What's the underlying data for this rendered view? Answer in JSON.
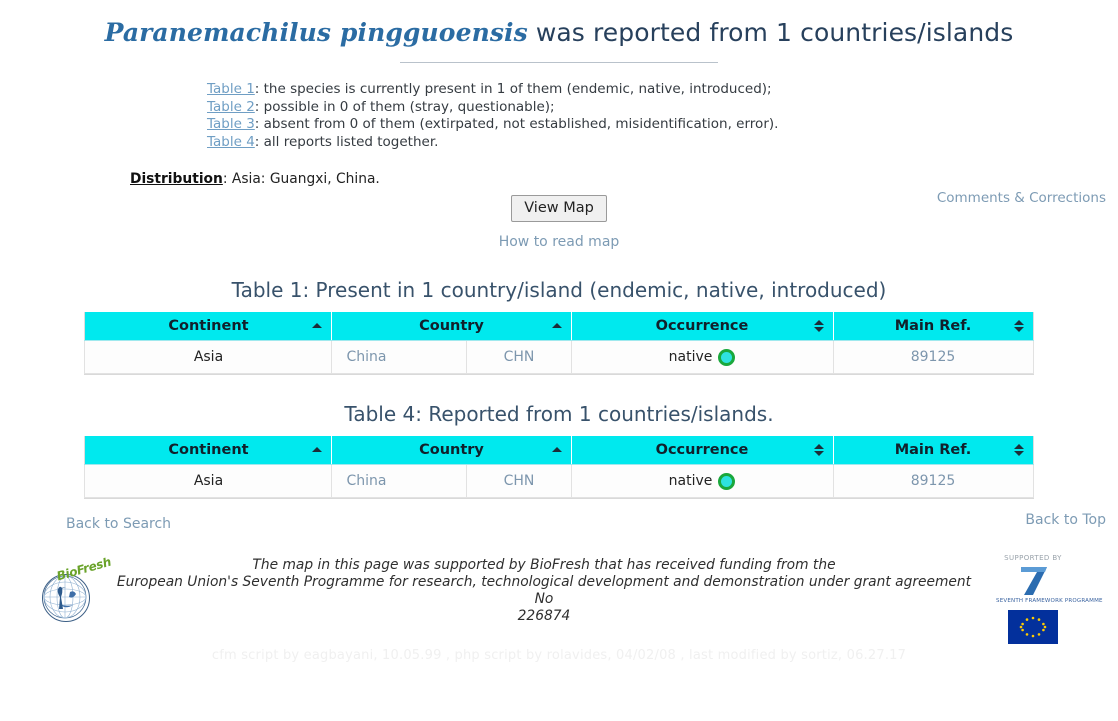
{
  "header": {
    "species_name": "Paranemachilus pingguoensis",
    "title_rest": " was reported from 1 countries/islands"
  },
  "legend": {
    "rows": [
      {
        "link": "Table 1",
        "text": ": the species is currently present in 1 of them (endemic, native, introduced);"
      },
      {
        "link": "Table 2",
        "text": ": possible in 0 of them (stray, questionable);"
      },
      {
        "link": "Table 3",
        "text": ": absent from 0 of them (extirpated, not established, misidentification, error)."
      },
      {
        "link": "Table 4",
        "text": ": all reports listed together."
      }
    ]
  },
  "distribution": {
    "label": "Distribution",
    "value": ": Asia: Guangxi, China."
  },
  "links": {
    "comments": "Comments & Corrections",
    "how_to_read_map": "How to read map",
    "back_to_search": "Back to Search",
    "back_to_top": "Back to Top"
  },
  "buttons": {
    "view_map": "View Map"
  },
  "tables": [
    {
      "caption": "Table 1: Present in 1 country/island (endemic, native, introduced)",
      "columns": [
        {
          "label": "Continent",
          "sort": "asc"
        },
        {
          "label": "Country",
          "sort": "asc"
        },
        {
          "label": "Occurrence",
          "sort": "none"
        },
        {
          "label": "Main Ref.",
          "sort": "none"
        }
      ],
      "rows": [
        {
          "continent": "Asia",
          "country": "China",
          "country_code": "CHN",
          "occurrence": "native",
          "occurrence_color": "#2ee2e0",
          "occurrence_ring": "#1aa83c",
          "main_ref": "89125"
        }
      ]
    },
    {
      "caption": "Table 4: Reported from 1 countries/islands.",
      "columns": [
        {
          "label": "Continent",
          "sort": "asc"
        },
        {
          "label": "Country",
          "sort": "asc"
        },
        {
          "label": "Occurrence",
          "sort": "none"
        },
        {
          "label": "Main Ref.",
          "sort": "none"
        }
      ],
      "rows": [
        {
          "continent": "Asia",
          "country": "China",
          "country_code": "CHN",
          "occurrence": "native",
          "occurrence_color": "#2ee2e0",
          "occurrence_ring": "#1aa83c",
          "main_ref": "89125"
        }
      ]
    }
  ],
  "footer": {
    "funding_line1": "The map in this page was supported by BioFresh that has received funding from the",
    "funding_line2": "European Union's Seventh Programme for research, technological development and demonstration under grant agreement No",
    "funding_line3": "226874",
    "biofresh_word": "BioFresh",
    "eu_supported_by": "SUPPORTED BY",
    "fp7_number": "7",
    "fp7_caption": "SEVENTH FRAMEWORK PROGRAMME",
    "script_credits": "cfm script by eagbayani, 10.05.99 ,  php script by rolavides, 04/02/08 ,  last modified by sortiz, 06.27.17"
  },
  "colors": {
    "header_cyan": "#00e9ee",
    "link_blue": "#7d9bb4",
    "title_blue": "#2b6ca3"
  }
}
